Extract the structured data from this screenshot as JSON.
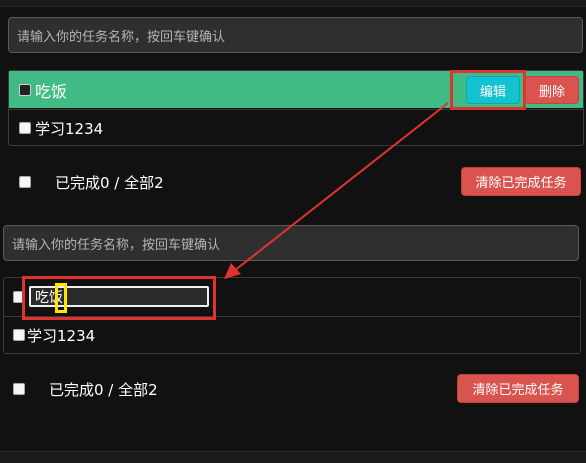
{
  "top": {
    "search": {
      "placeholder": "请输入你的任务名称，按回车键确认"
    },
    "todos": [
      {
        "text": "吃饭",
        "checked": false,
        "highlighted": true
      },
      {
        "text": "学习1234",
        "checked": false,
        "highlighted": false
      }
    ],
    "actions": {
      "edit_label": "编辑",
      "delete_label": "删除"
    },
    "footer": {
      "summary": "已完成0 / 全部2",
      "clear_label": "清除已完成任务"
    }
  },
  "bottom": {
    "search": {
      "placeholder": "请输入你的任务名称，按回车键确认"
    },
    "editing": {
      "value": "吃饭"
    },
    "todos": [
      {
        "text": "学习1234",
        "checked": false
      }
    ],
    "footer": {
      "summary": "已完成0 / 全部2",
      "clear_label": "清除已完成任务"
    }
  },
  "colors": {
    "background": "#111111",
    "highlight_row": "#41bb85",
    "edit_button": "#12c2cf",
    "danger": "#d9534f",
    "annotation_red": "#e0332f",
    "annotation_yellow": "#ffe600"
  },
  "icons": {
    "arrow": "annotation-arrow-icon"
  }
}
